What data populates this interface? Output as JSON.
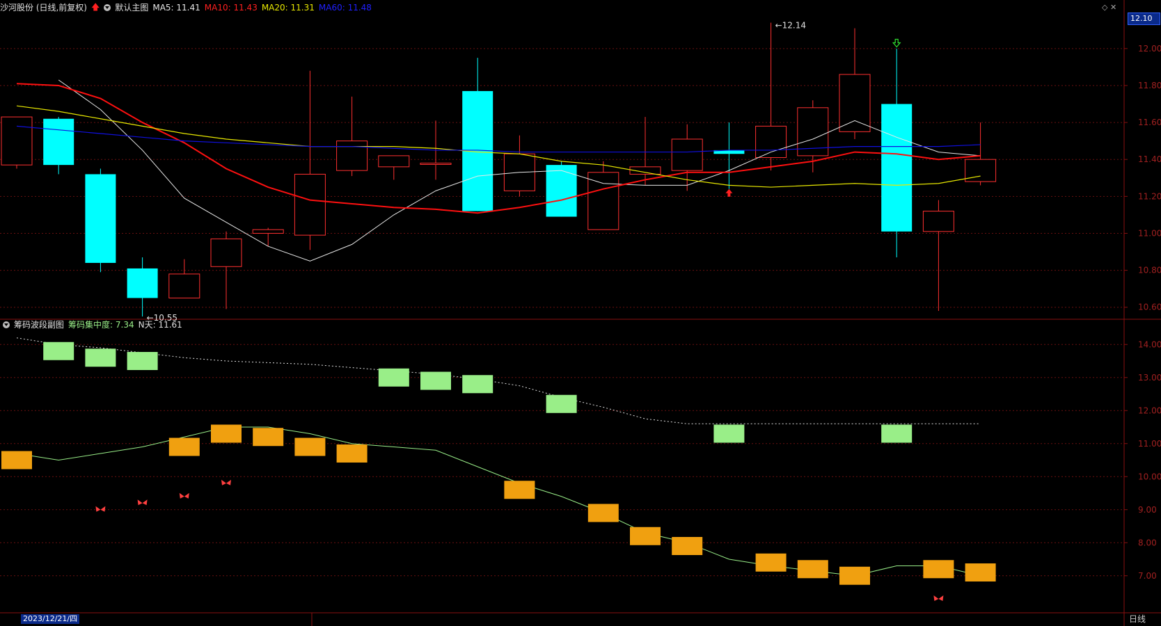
{
  "header": {
    "stock_name": "沙河股份 (日线,前复权)",
    "template": "默认主图",
    "ma5": "MA5: 11.41",
    "ma10": "MA10: 11.43",
    "ma20": "MA20: 11.31",
    "ma60": "MA60: 11.48",
    "current_price": "12.10"
  },
  "sub_header": {
    "title": "筹码波段副图",
    "concentration": "筹码集中度: 7.34",
    "n_days": "N天: 11.61"
  },
  "footer": {
    "date": "2023/12/21/四",
    "period": "日线"
  },
  "colors": {
    "up": "#ff3030",
    "down": "#00ffff",
    "ma5": "#e8e8e8",
    "ma10": "#ff1010",
    "ma20": "#e8e800",
    "ma60": "#1010e0",
    "grid": "#6a1010",
    "green_block": "#99ee88",
    "orange_block": "#f0a010"
  },
  "chart_data": [
    {
      "type": "candlestick",
      "y_ticks": [
        "12.00",
        "11.80",
        "11.60",
        "11.40",
        "11.20",
        "11.00",
        "10.80",
        "10.60"
      ],
      "ylim": [
        10.55,
        12.18
      ],
      "annotations": [
        {
          "label": "12.14",
          "candle": 18,
          "value": 12.14
        },
        {
          "label": "10.55",
          "candle": 3,
          "value": 10.55
        }
      ],
      "candles": [
        {
          "o": 11.37,
          "h": 11.63,
          "l": 11.35,
          "c": 11.63
        },
        {
          "o": 11.62,
          "h": 11.63,
          "l": 11.32,
          "c": 11.37
        },
        {
          "o": 11.32,
          "h": 11.35,
          "l": 10.79,
          "c": 10.84
        },
        {
          "o": 10.81,
          "h": 10.87,
          "l": 10.55,
          "c": 10.65
        },
        {
          "o": 10.65,
          "h": 10.86,
          "l": 10.65,
          "c": 10.78
        },
        {
          "o": 10.82,
          "h": 11.01,
          "l": 10.59,
          "c": 10.97
        },
        {
          "o": 11.0,
          "h": 11.03,
          "l": 10.93,
          "c": 11.02
        },
        {
          "o": 10.99,
          "h": 11.88,
          "l": 10.91,
          "c": 11.32
        },
        {
          "o": 11.34,
          "h": 11.74,
          "l": 11.31,
          "c": 11.5
        },
        {
          "o": 11.36,
          "h": 11.42,
          "l": 11.29,
          "c": 11.42
        },
        {
          "o": 11.38,
          "h": 11.61,
          "l": 11.29,
          "c": 11.38
        },
        {
          "o": 11.77,
          "h": 11.95,
          "l": 11.12,
          "c": 11.12
        },
        {
          "o": 11.23,
          "h": 11.53,
          "l": 11.2,
          "c": 11.43
        },
        {
          "o": 11.37,
          "h": 11.39,
          "l": 11.09,
          "c": 11.09
        },
        {
          "o": 11.02,
          "h": 11.39,
          "l": 11.02,
          "c": 11.33
        },
        {
          "o": 11.32,
          "h": 11.63,
          "l": 11.26,
          "c": 11.36
        },
        {
          "o": 11.34,
          "h": 11.59,
          "l": 11.23,
          "c": 11.51
        },
        {
          "o": 11.45,
          "h": 11.6,
          "l": 11.24,
          "c": 11.43
        },
        {
          "o": 11.41,
          "h": 12.14,
          "l": 11.34,
          "c": 11.58
        },
        {
          "o": 11.42,
          "h": 11.72,
          "l": 11.33,
          "c": 11.68
        },
        {
          "o": 11.55,
          "h": 12.11,
          "l": 11.51,
          "c": 11.86
        },
        {
          "o": 11.7,
          "h": 12.0,
          "l": 10.87,
          "c": 11.01
        },
        {
          "o": 11.01,
          "h": 11.18,
          "l": 10.58,
          "c": 11.12
        },
        {
          "o": 11.28,
          "h": 11.6,
          "l": 11.26,
          "c": 11.4
        }
      ],
      "series": [
        {
          "name": "MA5",
          "values": [
            11.83,
            11.67,
            11.45,
            11.19,
            11.06,
            10.93,
            10.85,
            10.94,
            11.1,
            11.23,
            11.31,
            11.33,
            11.34,
            11.27,
            11.26,
            11.26,
            11.34,
            11.44,
            11.51,
            11.61,
            11.52,
            11.44,
            11.42
          ]
        },
        {
          "name": "MA10",
          "values": [
            11.81,
            11.8,
            11.73,
            11.6,
            11.49,
            11.35,
            11.25,
            11.18,
            11.16,
            11.14,
            11.13,
            11.11,
            11.14,
            11.18,
            11.24,
            11.29,
            11.33,
            11.33,
            11.36,
            11.39,
            11.44,
            11.43,
            11.4,
            11.42
          ]
        },
        {
          "name": "MA20",
          "values": [
            11.69,
            11.66,
            11.62,
            11.58,
            11.54,
            11.51,
            11.49,
            11.47,
            11.47,
            11.47,
            11.46,
            11.44,
            11.43,
            11.39,
            11.37,
            11.33,
            11.29,
            11.26,
            11.25,
            11.26,
            11.27,
            11.26,
            11.27,
            11.31
          ]
        },
        {
          "name": "MA60",
          "values": [
            11.58,
            11.56,
            11.54,
            11.52,
            11.5,
            11.49,
            11.48,
            11.47,
            11.47,
            11.46,
            11.45,
            11.45,
            11.44,
            11.44,
            11.44,
            11.44,
            11.44,
            11.45,
            11.45,
            11.46,
            11.47,
            11.47,
            11.47,
            11.48
          ]
        }
      ],
      "up_marker": {
        "candle": 17,
        "at": 11.24
      },
      "down_marker": {
        "candle": 21,
        "at": 12.05
      }
    },
    {
      "type": "bar",
      "y_ticks": [
        "14.00",
        "13.00",
        "12.00",
        "11.00",
        "10.00",
        "9.00",
        "8.00",
        "7.00"
      ],
      "ylim": [
        5.9,
        14.7
      ],
      "green_blocks": [
        {
          "candle": 1,
          "value": 13.8
        },
        {
          "candle": 2,
          "value": 13.6
        },
        {
          "candle": 3,
          "value": 13.5
        },
        {
          "candle": 9,
          "value": 13.0
        },
        {
          "candle": 10,
          "value": 12.9
        },
        {
          "candle": 11,
          "value": 12.8
        },
        {
          "candle": 13,
          "value": 12.2
        },
        {
          "candle": 17,
          "value": 11.3
        },
        {
          "candle": 21,
          "value": 11.3
        }
      ],
      "orange_blocks": [
        {
          "candle": 0,
          "value": 10.5
        },
        {
          "candle": 4,
          "value": 10.9
        },
        {
          "candle": 5,
          "value": 11.3
        },
        {
          "candle": 6,
          "value": 11.2
        },
        {
          "candle": 7,
          "value": 10.9
        },
        {
          "candle": 8,
          "value": 10.7
        },
        {
          "candle": 12,
          "value": 9.6
        },
        {
          "candle": 14,
          "value": 8.9
        },
        {
          "candle": 15,
          "value": 8.2
        },
        {
          "candle": 16,
          "value": 7.9
        },
        {
          "candle": 18,
          "value": 7.4
        },
        {
          "candle": 19,
          "value": 7.2
        },
        {
          "candle": 20,
          "value": 7.0
        },
        {
          "candle": 22,
          "value": 7.2
        },
        {
          "candle": 23,
          "value": 7.1
        }
      ],
      "dotted_line": [
        14.2,
        14.0,
        13.9,
        13.75,
        13.6,
        13.5,
        13.45,
        13.4,
        13.3,
        13.2,
        13.1,
        12.95,
        12.75,
        12.4,
        12.1,
        11.75,
        11.6,
        11.6,
        11.6,
        11.6,
        11.6,
        11.6,
        11.6,
        11.6
      ],
      "green_line": [
        10.7,
        10.5,
        10.7,
        10.9,
        11.2,
        11.5,
        11.5,
        11.3,
        11.0,
        10.9,
        10.8,
        10.3,
        9.8,
        9.4,
        8.9,
        8.3,
        8.0,
        7.5,
        7.3,
        7.15,
        7.0,
        7.3,
        7.3,
        7.0
      ],
      "butterflies": [
        {
          "candle": 2,
          "value": 9.0
        },
        {
          "candle": 3,
          "value": 9.2
        },
        {
          "candle": 4,
          "value": 9.4
        },
        {
          "candle": 5,
          "value": 9.8
        },
        {
          "candle": 22,
          "value": 6.3
        }
      ]
    }
  ]
}
